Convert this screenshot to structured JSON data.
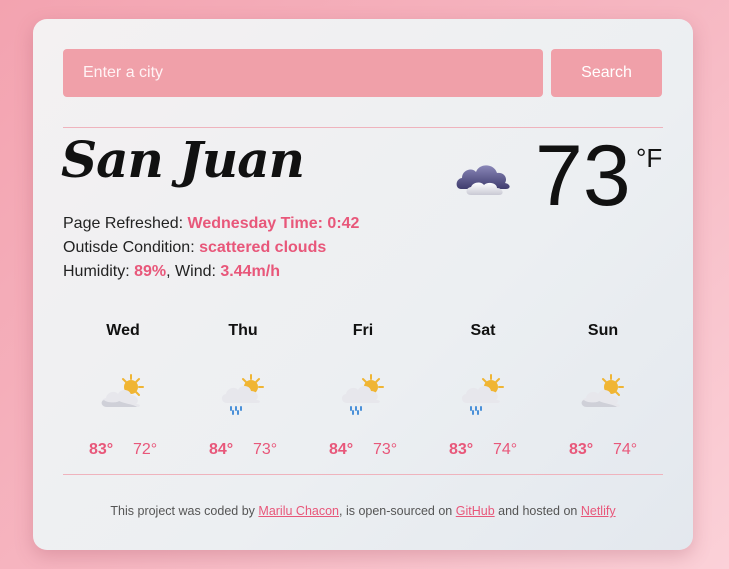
{
  "search": {
    "placeholder": "Enter a city",
    "button_label": "Search"
  },
  "current": {
    "city": "San Juan",
    "refreshed_label": "Page Refreshed: ",
    "refreshed_value": "Wednesday Time: 0:42",
    "condition_label": "Outisde Condition: ",
    "condition_value": "scattered clouds",
    "humidity_label": "Humidity: ",
    "humidity_value": "89%",
    "wind_label": ", Wind: ",
    "wind_value": "3.44m/h",
    "temperature": "73",
    "unit": "°F",
    "icon": "cloud-icon"
  },
  "forecast": [
    {
      "day": "Wed",
      "high": "83°",
      "low": "72°",
      "icon": "partly-cloudy-icon"
    },
    {
      "day": "Thu",
      "high": "84°",
      "low": "73°",
      "icon": "partly-cloudy-rain-icon"
    },
    {
      "day": "Fri",
      "high": "84°",
      "low": "73°",
      "icon": "partly-cloudy-rain-icon"
    },
    {
      "day": "Sat",
      "high": "83°",
      "low": "74°",
      "icon": "partly-cloudy-rain-icon"
    },
    {
      "day": "Sun",
      "high": "83°",
      "low": "74°",
      "icon": "partly-cloudy-icon"
    }
  ],
  "footer": {
    "text1": "This project was coded by ",
    "author": "Marilu Chacon",
    "text2": ", is open-sourced on ",
    "github": "GitHub",
    "text3": " and hosted on ",
    "netlify": "Netlify"
  },
  "colors": {
    "accent": "#e8577a",
    "input_bg": "#f0a0a9"
  }
}
